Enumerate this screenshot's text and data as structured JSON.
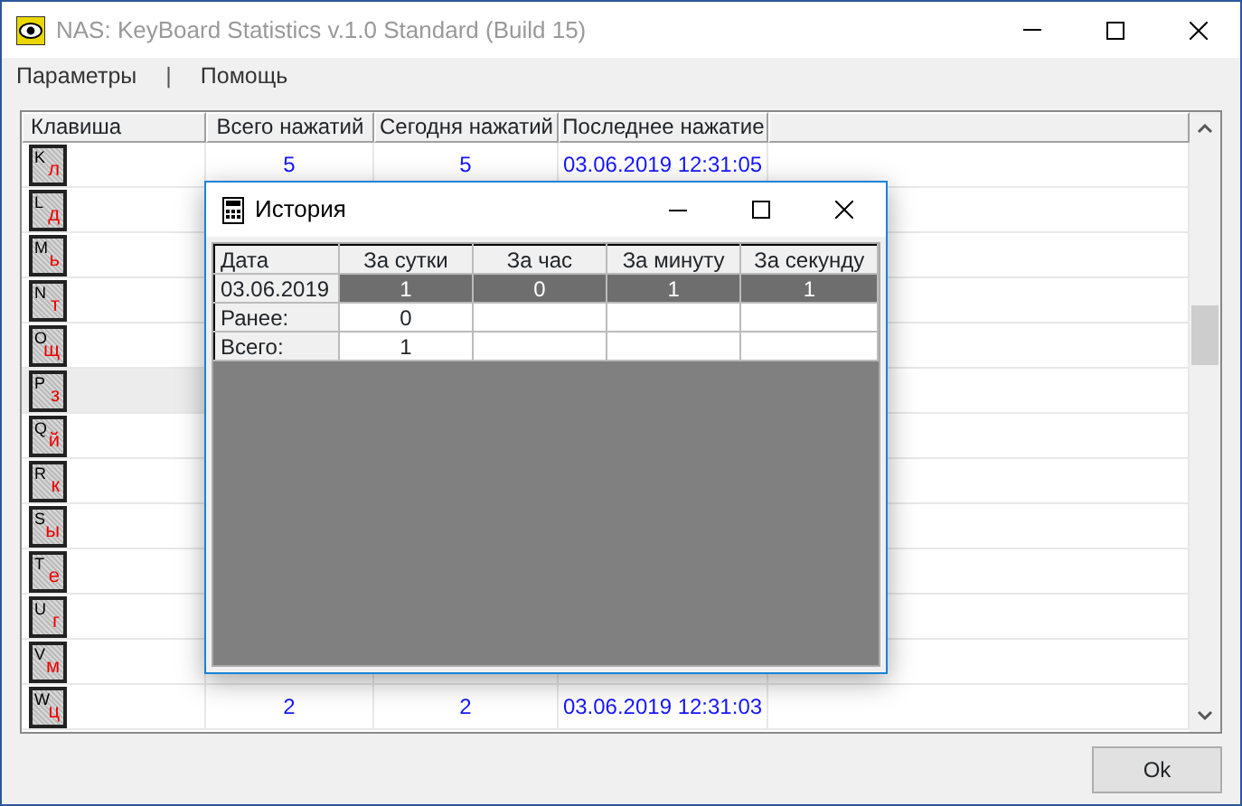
{
  "window": {
    "title": "NAS: KeyBoard Statistics v.1.0 Standard (Build 15)"
  },
  "menu": [
    {
      "label": "Параметры"
    },
    {
      "label": "|",
      "kind": "separator"
    },
    {
      "label": "Помощь"
    }
  ],
  "table": {
    "columns": [
      "Клавиша",
      "Всего нажатий",
      "Сегодня нажатий",
      "Последнее нажатие"
    ],
    "rows": [
      {
        "key": "K",
        "alt": "л",
        "selected": false,
        "total": "5",
        "today": "5",
        "last": "03.06.2019 12:31:05"
      },
      {
        "key": "L",
        "alt": "д",
        "selected": false
      },
      {
        "key": "M",
        "alt": "ь",
        "selected": false
      },
      {
        "key": "N",
        "alt": "т",
        "selected": false
      },
      {
        "key": "O",
        "alt": "щ",
        "selected": false
      },
      {
        "key": "P",
        "alt": "з",
        "selected": true
      },
      {
        "key": "Q",
        "alt": "й",
        "selected": false
      },
      {
        "key": "R",
        "alt": "к",
        "selected": false
      },
      {
        "key": "S",
        "alt": "ы",
        "selected": false
      },
      {
        "key": "T",
        "alt": "е",
        "selected": false
      },
      {
        "key": "U",
        "alt": "г",
        "selected": false
      },
      {
        "key": "V",
        "alt": "м",
        "selected": false
      },
      {
        "key": "W",
        "alt": "ц",
        "selected": false,
        "total": "2",
        "today": "2",
        "last": "03.06.2019 12:31:03"
      }
    ]
  },
  "ok_button": "Ok",
  "dialog": {
    "title": "История",
    "columns": [
      "Дата",
      "За сутки",
      "За час",
      "За минуту",
      "За секунду"
    ],
    "rows": [
      {
        "cells": [
          "03.06.2019",
          "1",
          "0",
          "1",
          "1"
        ],
        "selected": true
      },
      {
        "cells": [
          "Ранее:",
          "0",
          "",
          "",
          ""
        ],
        "selected": false
      },
      {
        "cells": [
          "Всего:",
          "1",
          "",
          "",
          ""
        ],
        "selected": false
      }
    ]
  }
}
